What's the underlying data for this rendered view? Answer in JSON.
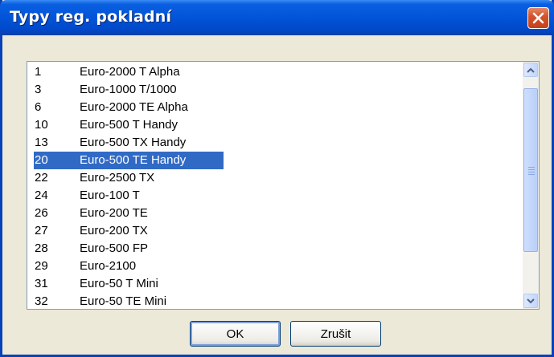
{
  "window": {
    "title": "Typy reg. pokladní"
  },
  "list": {
    "selected_index": 5,
    "items": [
      {
        "code": "1",
        "name": "Euro-2000 T Alpha"
      },
      {
        "code": "3",
        "name": "Euro-1000 T/1000"
      },
      {
        "code": "6",
        "name": "Euro-2000 TE Alpha"
      },
      {
        "code": "10",
        "name": "Euro-500 T Handy"
      },
      {
        "code": "13",
        "name": "Euro-500 TX Handy"
      },
      {
        "code": "20",
        "name": "Euro-500 TE Handy"
      },
      {
        "code": "22",
        "name": "Euro-2500 TX"
      },
      {
        "code": "24",
        "name": "Euro-100 T"
      },
      {
        "code": "26",
        "name": "Euro-200 TE"
      },
      {
        "code": "27",
        "name": "Euro-200 TX"
      },
      {
        "code": "28",
        "name": "Euro-500 FP"
      },
      {
        "code": "29",
        "name": "Euro-2100"
      },
      {
        "code": "31",
        "name": "Euro-50 T Mini"
      },
      {
        "code": "32",
        "name": "Euro-50 TE Mini"
      }
    ]
  },
  "buttons": {
    "ok_label": "OK",
    "cancel_label": "Zrušit"
  },
  "colors": {
    "selection": "#316ac5",
    "titlebar": "#0254d9",
    "close": "#d5532c"
  }
}
